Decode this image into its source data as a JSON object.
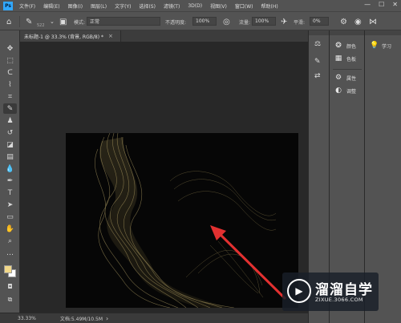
{
  "app": {
    "logo": "Ps"
  },
  "menu": [
    "文件(F)",
    "编辑(E)",
    "图像(I)",
    "图层(L)",
    "文字(Y)",
    "选择(S)",
    "滤镜(T)",
    "3D(D)",
    "视图(V)",
    "窗口(W)",
    "帮助(H)"
  ],
  "window_controls": {
    "minimize": "—",
    "maximize": "☐",
    "close": "✕"
  },
  "options": {
    "brush_size": "522",
    "mode_label": "模式:",
    "mode_value": "正常",
    "opacity_label": "不透明度:",
    "opacity_value": "100%",
    "flow_label": "流量:",
    "flow_value": "100%",
    "smooth_label": "平滑:",
    "smooth_value": "0%"
  },
  "document": {
    "tab_title": "未标题-1 @ 33.3% (背景, RGB/8) *",
    "tab_close": "×"
  },
  "status": {
    "zoom": "33.33%",
    "doc_size": "文档:5.49M/10.5M",
    "arrow": "›"
  },
  "colors": {
    "foreground": "#f2d889",
    "background": "#ffffff",
    "accent_arrow": "#e23030"
  },
  "panels": {
    "color_label": "颜色",
    "swatches_label": "色板",
    "properties_label": "属性",
    "adjustments_label": "调整",
    "learn_label": "学习"
  },
  "icons": {
    "tools": [
      "move-icon",
      "marquee-icon",
      "lasso-icon",
      "quick-select-icon",
      "crop-icon",
      "eyedropper-icon",
      "brush-icon",
      "stamp-icon",
      "history-brush-icon",
      "eraser-icon",
      "gradient-icon",
      "blur-icon",
      "dodge-icon",
      "pen-icon",
      "type-icon",
      "path-select-icon",
      "rectangle-icon",
      "hand-icon",
      "zoom-icon",
      "more-icon",
      "swap-colors-icon",
      "quick-mask-icon",
      "screen-mode-icon"
    ]
  },
  "watermark": {
    "title": "溜溜自学",
    "url": "ZIXUE.3066.COM",
    "logo_glyph": "▶"
  }
}
